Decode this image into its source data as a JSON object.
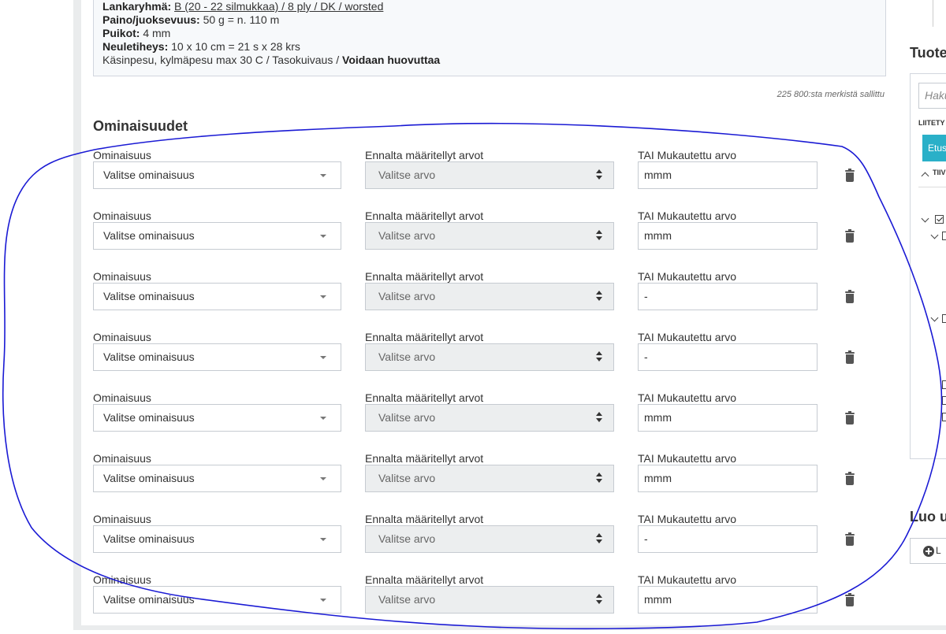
{
  "description": {
    "line1_label": "Lankaryhmä:",
    "line1_value": "B (20 - 22 silmukkaa) / 8 ply / DK / worsted",
    "line2_label": "Paino/juoksevuus:",
    "line2_value": "50 g = n. 110 m",
    "line3_label": "Puikot:",
    "line3_value": "4 mm",
    "line4_label": "Neuletiheys:",
    "line4_value": "10 x 10 cm = 21 s x 28 krs",
    "line5_text": "Käsinpesu, kylmäpesu max 30 C / Tasokuivaus /",
    "line5_bold": "Voidaan huovuttaa"
  },
  "char_counter": "225 800:sta merkistä sallittu",
  "properties": {
    "title": "Ominaisuudet",
    "rows": [
      {
        "label_property": "Ominaisuus",
        "label_predefined": "Ennalta määritellyt arvot",
        "label_custom": "TAI Mukautettu arvo",
        "property_value": "Valitse ominaisuus",
        "predefined_value": "Valitse arvo",
        "custom_value": "mmm"
      },
      {
        "label_property": "Ominaisuus",
        "label_predefined": "Ennalta määritellyt arvot",
        "label_custom": "TAI Mukautettu arvo",
        "property_value": "Valitse ominaisuus",
        "predefined_value": "Valitse arvo",
        "custom_value": "mmm"
      },
      {
        "label_property": "Ominaisuus",
        "label_predefined": "Ennalta määritellyt arvot",
        "label_custom": "TAI Mukautettu arvo",
        "property_value": "Valitse ominaisuus",
        "predefined_value": "Valitse arvo",
        "custom_value": "-"
      },
      {
        "label_property": "Ominaisuus",
        "label_predefined": "Ennalta määritellyt arvot",
        "label_custom": "TAI Mukautettu arvo",
        "property_value": "Valitse ominaisuus",
        "predefined_value": "Valitse arvo",
        "custom_value": "-"
      },
      {
        "label_property": "Ominaisuus",
        "label_predefined": "Ennalta määritellyt arvot",
        "label_custom": "TAI Mukautettu arvo",
        "property_value": "Valitse ominaisuus",
        "predefined_value": "Valitse arvo",
        "custom_value": "mmm"
      },
      {
        "label_property": "Ominaisuus",
        "label_predefined": "Ennalta määritellyt arvot",
        "label_custom": "TAI Mukautettu arvo",
        "property_value": "Valitse ominaisuus",
        "predefined_value": "Valitse arvo",
        "custom_value": "mmm"
      },
      {
        "label_property": "Ominaisuus",
        "label_predefined": "Ennalta määritellyt arvot",
        "label_custom": "TAI Mukautettu arvo",
        "property_value": "Valitse ominaisuus",
        "predefined_value": "Valitse arvo",
        "custom_value": "-"
      },
      {
        "label_property": "Ominaisuus",
        "label_predefined": "Ennalta määritellyt arvot",
        "label_custom": "TAI Mukautettu arvo",
        "property_value": "Valitse ominaisuus",
        "predefined_value": "Valitse arvo",
        "custom_value": "mmm"
      }
    ]
  },
  "right_panel": {
    "title": "Tuote",
    "search_placeholder": "Haku",
    "attached_label": "LIITETY",
    "chip_label": "Etus",
    "collapse_label": "TIIV",
    "create_title": "Luo u",
    "create_button": "L"
  },
  "colors": {
    "accent_chip": "#2ab0c8",
    "annotation_stroke": "#1a1ad4"
  }
}
